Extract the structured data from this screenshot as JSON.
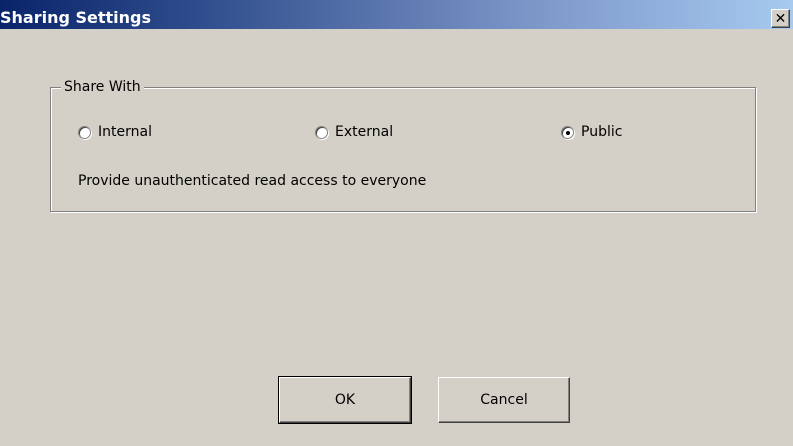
{
  "window": {
    "title": "Sharing Settings",
    "close_icon": "close-icon",
    "close_glyph": "✕"
  },
  "share_with": {
    "legend": "Share With",
    "options": [
      {
        "label": "Internal",
        "selected": false
      },
      {
        "label": "External",
        "selected": false
      },
      {
        "label": "Public",
        "selected": true
      }
    ],
    "description": "Provide unauthenticated read access to everyone"
  },
  "buttons": {
    "ok_label": "OK",
    "cancel_label": "Cancel"
  },
  "colors": {
    "title_gradient_start": "#0a246a",
    "title_gradient_end": "#a6caf0",
    "dialog_background": "#d4d0c8"
  }
}
